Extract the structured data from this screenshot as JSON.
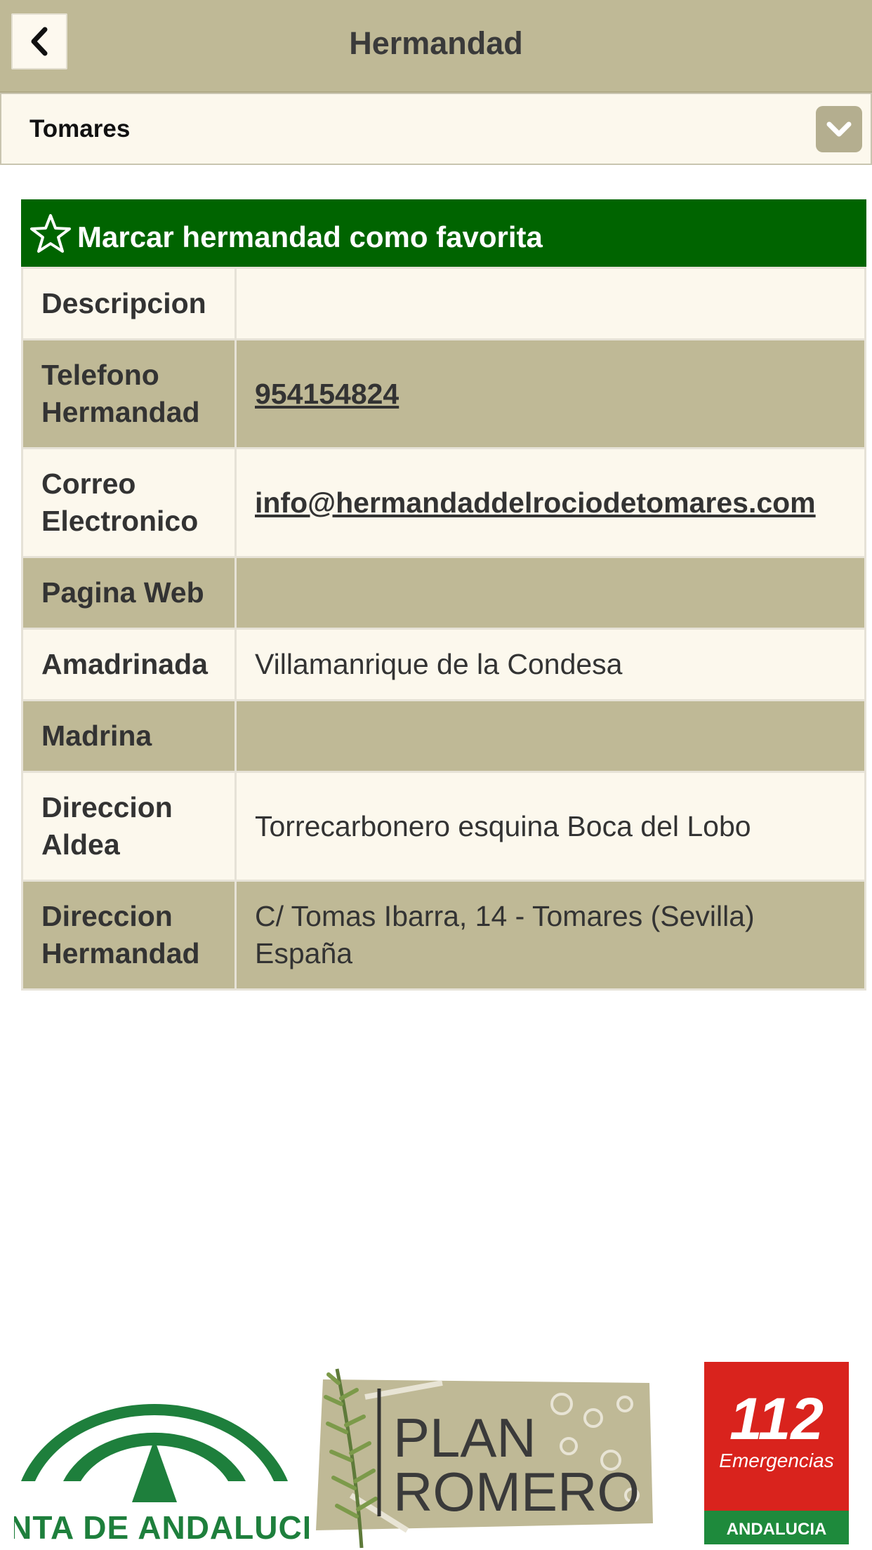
{
  "header": {
    "title": "Hermandad"
  },
  "selector": {
    "value": "Tomares"
  },
  "favorite": {
    "label": "Marcar hermandad como favorita"
  },
  "details": [
    {
      "key": "Descripcion",
      "value": "",
      "link": false
    },
    {
      "key": "Telefono Hermandad",
      "value": "954154824",
      "link": true
    },
    {
      "key": "Correo Electronico",
      "value": "info@hermandaddelrociodetomares.com",
      "link": true
    },
    {
      "key": "Pagina Web",
      "value": "",
      "link": false
    },
    {
      "key": "Amadrinada",
      "value": "Villamanrique de la Condesa",
      "link": false
    },
    {
      "key": "Madrina",
      "value": "",
      "link": false
    },
    {
      "key": "Direccion Aldea",
      "value": "Torrecarbonero esquina Boca del Lobo",
      "link": false
    },
    {
      "key": "Direccion Hermandad",
      "value": "C/ Tomas Ibarra, 14 - Tomares (Sevilla) España",
      "link": false
    }
  ],
  "footer": {
    "junta_text": "JUNTA DE ANDALUCIA",
    "plan_line1": "PLAN",
    "plan_line2": "ROMERO",
    "emergencias_number": "112",
    "emergencias_text": "Emergencias",
    "emergencias_region": "ANDALUCIA"
  },
  "colors": {
    "header_bg": "#bfb996",
    "favorite_bg": "#006400",
    "row_light": "#fcf8ed",
    "row_dark": "#bfb996",
    "junta_green": "#1e7f3c",
    "emergency_red": "#d9231d"
  },
  "icons": [
    "back-icon",
    "chevron-down-icon",
    "star-icon"
  ]
}
